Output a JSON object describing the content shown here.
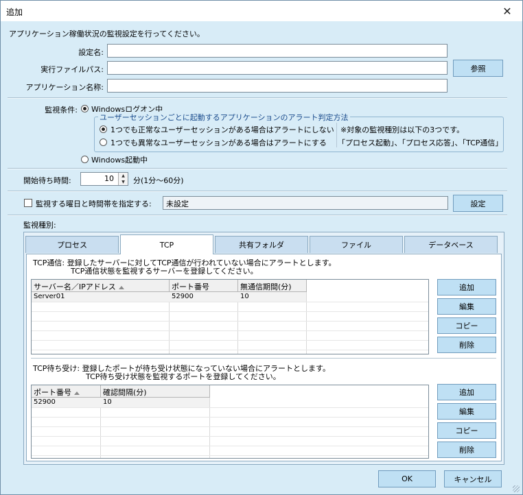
{
  "window": {
    "title": "追加",
    "close_glyph": "✕"
  },
  "intro": "アプリケーション稼働状況の監視設定を行ってください。",
  "fields": {
    "setting_name_label": "設定名:",
    "exe_path_label": "実行ファイルパス:",
    "app_name_label": "アプリケーション名称:",
    "browse_button": "参照"
  },
  "condition": {
    "label": "監視条件:",
    "option_logon": "Windowsログオン中",
    "group_title": "ユーザーセッションごとに起動するアプリケーションのアラート判定方法",
    "option_normal": "1つでも正常なユーザーセッションがある場合はアラートにしない",
    "option_abnormal": "1つでも異常なユーザーセッションがある場合はアラートにする",
    "note_line1": "※対象の監視種別は以下の3つです。",
    "note_line2": "「プロセス起動」、「プロセス応答」、「TCP通信」",
    "option_startup": "Windows起動中"
  },
  "wait": {
    "label": "開始待ち時間:",
    "value": "10",
    "unit": "分(1分～60分)"
  },
  "schedule": {
    "label": "監視する曜日と時間帯を指定する:",
    "value": "未設定",
    "button": "設定"
  },
  "monitor_type_label": "監視種別:",
  "tabs": [
    {
      "label": "プロセス"
    },
    {
      "label": "TCP"
    },
    {
      "label": "共有フォルダ"
    },
    {
      "label": "ファイル"
    },
    {
      "label": "データベース"
    }
  ],
  "tcp_comm": {
    "desc_line1": "TCP通信: 登録したサーバーに対してTCP通信が行われていない場合にアラートとします。",
    "desc_line2": "TCP通信状態を監視するサーバーを登録してください。",
    "columns": [
      "サーバー名／IPアドレス",
      "ポート番号",
      "無通信期間(分)"
    ],
    "rows": [
      [
        "Server01",
        "52900",
        "10"
      ]
    ],
    "buttons": {
      "add": "追加",
      "edit": "編集",
      "copy": "コピー",
      "delete": "削除"
    }
  },
  "tcp_listen": {
    "desc_line1": "TCP待ち受け: 登録したポートが待ち受け状態になっていない場合にアラートとします。",
    "desc_line2": "TCP待ち受け状態を監視するポートを登録してください。",
    "columns": [
      "ポート番号",
      "確認間隔(分)"
    ],
    "rows": [
      [
        "52900",
        "10"
      ]
    ],
    "buttons": {
      "add": "追加",
      "edit": "編集",
      "copy": "コピー",
      "delete": "削除"
    }
  },
  "footer": {
    "ok": "OK",
    "cancel": "キャンセル"
  }
}
